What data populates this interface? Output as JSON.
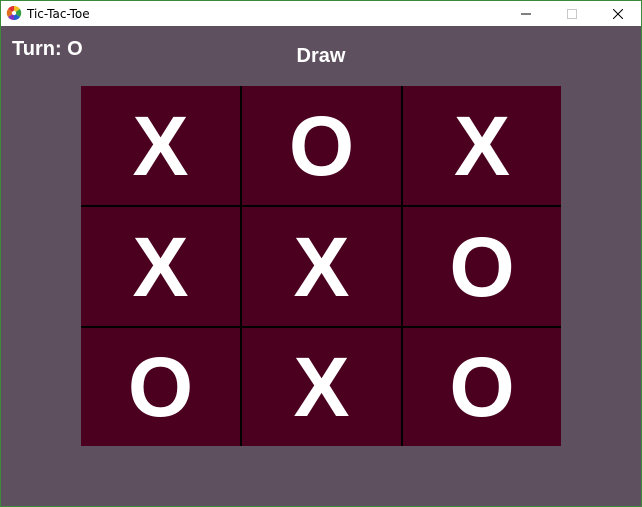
{
  "window": {
    "title": "Tic-Tac-Toe"
  },
  "game": {
    "turn_text": "Turn: O",
    "status_text": "Draw",
    "board": [
      "X",
      "O",
      "X",
      "X",
      "X",
      "O",
      "O",
      "X",
      "O"
    ]
  },
  "colors": {
    "background": "#5e505e",
    "cell": "#4b001f",
    "grid_line": "#000000",
    "mark": "#ffffff"
  },
  "icons": {
    "app": "color-wheel-icon",
    "minimize": "minimize-icon",
    "maximize": "maximize-icon",
    "close": "close-icon"
  }
}
